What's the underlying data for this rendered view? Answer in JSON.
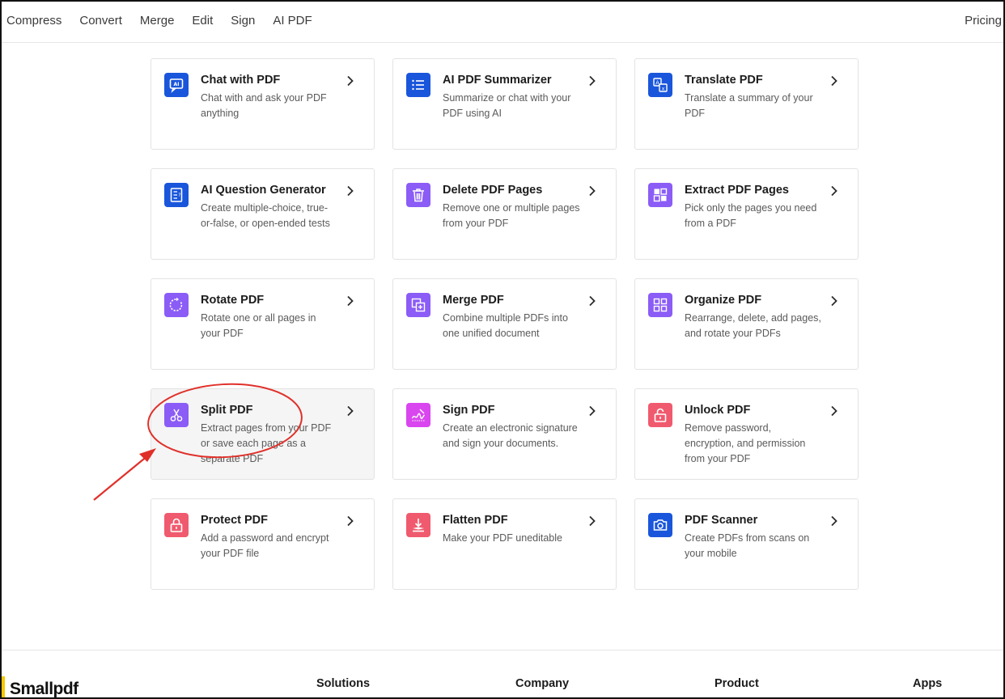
{
  "nav": {
    "items": [
      "Compress",
      "Convert",
      "Merge",
      "Edit",
      "Sign",
      "AI PDF"
    ],
    "pricing": "Pricing"
  },
  "tools": [
    {
      "title": "Chat with PDF",
      "desc": "Chat with and ask your PDF anything",
      "icon": "chat-ai-icon",
      "color": "#1a56db"
    },
    {
      "title": "AI PDF Summarizer",
      "desc": "Summarize or chat with your PDF using AI",
      "icon": "list-icon",
      "color": "#1a56db"
    },
    {
      "title": "Translate PDF",
      "desc": "Translate a summary of your PDF",
      "icon": "translate-icon",
      "color": "#1a56db"
    },
    {
      "title": "AI Question Generator",
      "desc": "Create multiple-choice, true-or-false, or open-ended tests",
      "icon": "question-doc-icon",
      "color": "#1a56db"
    },
    {
      "title": "Delete PDF Pages",
      "desc": "Remove one or multiple pages from your PDF",
      "icon": "trash-icon",
      "color": "#8b5cf6"
    },
    {
      "title": "Extract PDF Pages",
      "desc": "Pick only the pages you need from a PDF",
      "icon": "extract-grid-icon",
      "color": "#8b5cf6"
    },
    {
      "title": "Rotate PDF",
      "desc": "Rotate one or all pages in your PDF",
      "icon": "rotate-icon",
      "color": "#8b5cf6"
    },
    {
      "title": "Merge PDF",
      "desc": "Combine multiple PDFs into one unified document",
      "icon": "merge-icon",
      "color": "#8b5cf6"
    },
    {
      "title": "Organize PDF",
      "desc": "Rearrange, delete, add pages, and rotate your PDFs",
      "icon": "organize-grid-icon",
      "color": "#8b5cf6"
    },
    {
      "title": "Split PDF",
      "desc": "Extract pages from your PDF or save each page as a separate PDF",
      "icon": "scissors-icon",
      "color": "#8b5cf6"
    },
    {
      "title": "Sign PDF",
      "desc": "Create an electronic signature and sign your documents.",
      "icon": "signature-icon",
      "color": "#d946ef"
    },
    {
      "title": "Unlock PDF",
      "desc": "Remove password, encryption, and permission from your PDF",
      "icon": "unlock-icon",
      "color": "#f05a6e"
    },
    {
      "title": "Protect PDF",
      "desc": "Add a password and encrypt your PDF file",
      "icon": "lock-icon",
      "color": "#f05a6e"
    },
    {
      "title": "Flatten PDF",
      "desc": "Make your PDF uneditable",
      "icon": "flatten-icon",
      "color": "#f05a6e"
    },
    {
      "title": "PDF Scanner",
      "desc": "Create PDFs from scans on your mobile",
      "icon": "camera-icon",
      "color": "#1a56db"
    }
  ],
  "footer": {
    "logo": "Smallpdf",
    "columns": [
      "Solutions",
      "Company",
      "Product",
      "Apps"
    ]
  },
  "annotation": {
    "target": "Split PDF",
    "color": "#e0302a"
  }
}
